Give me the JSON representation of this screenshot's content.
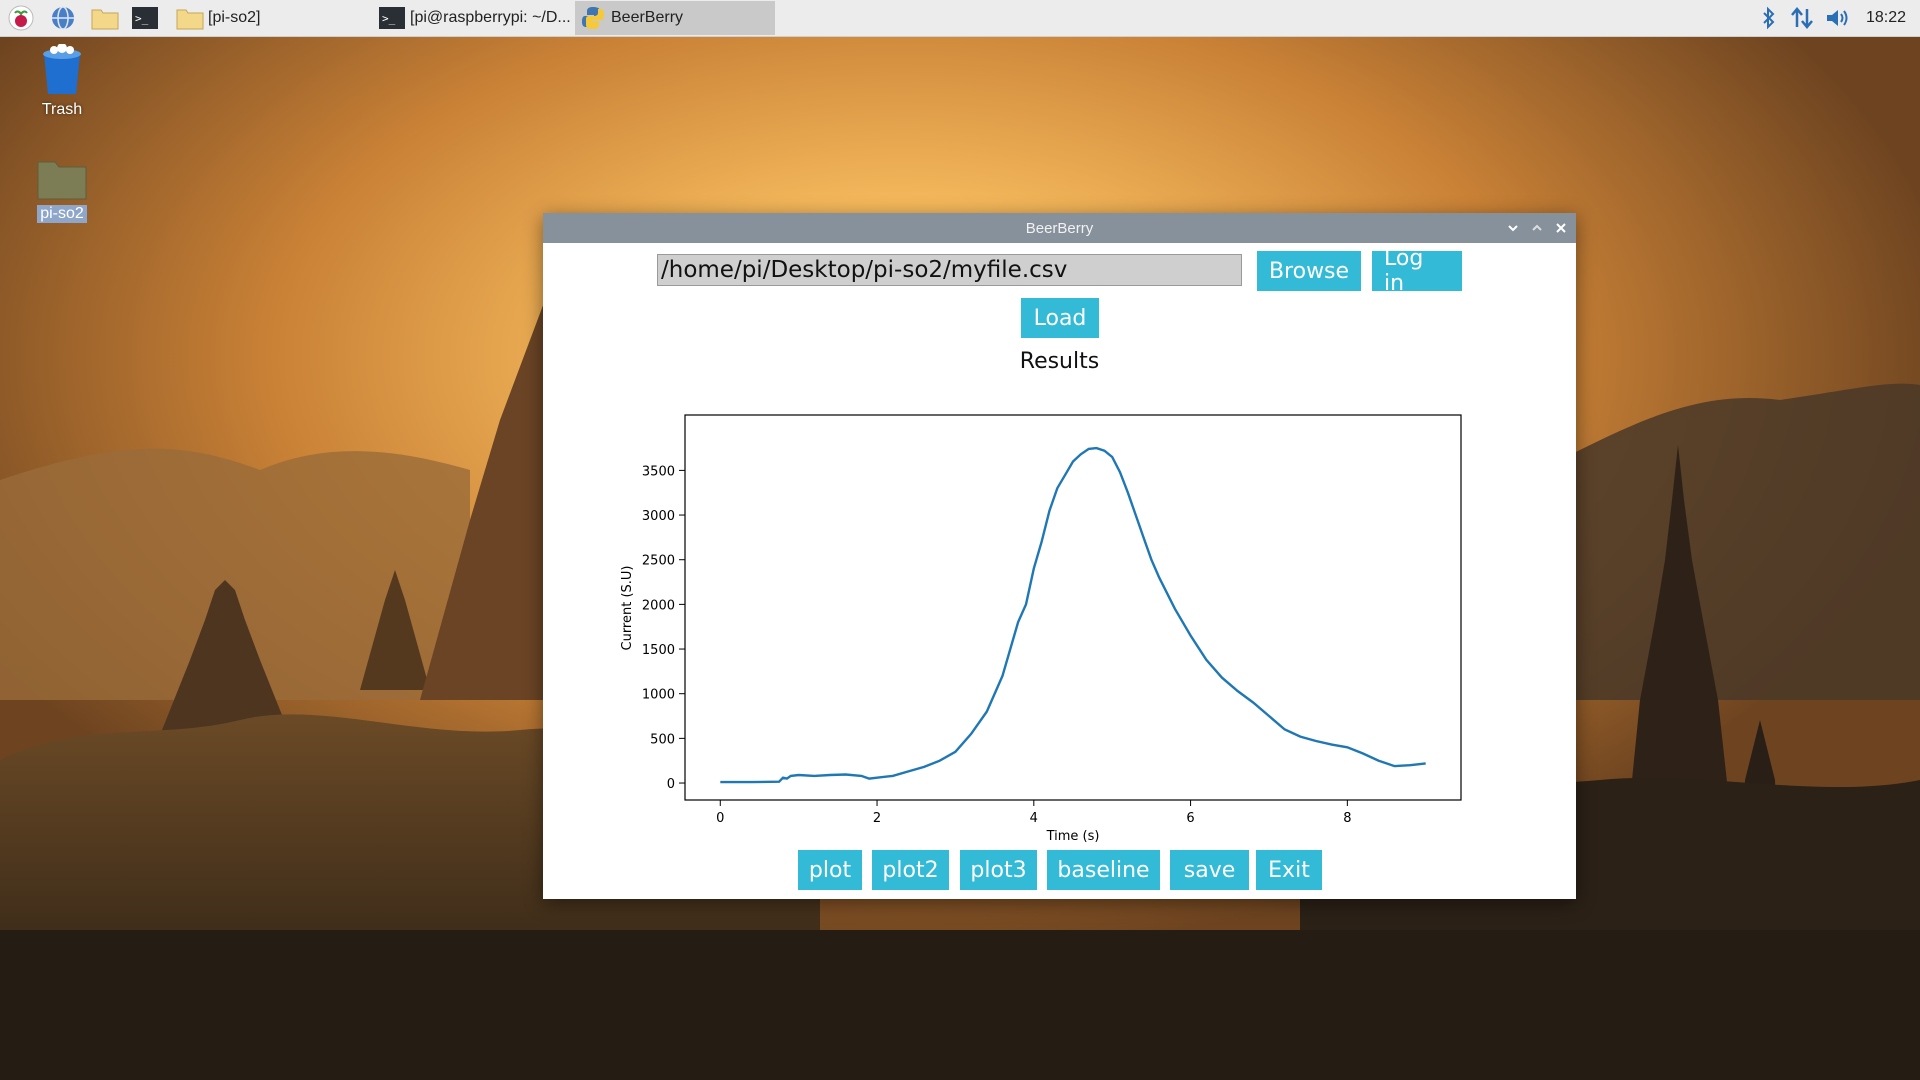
{
  "taskbar": {
    "tasks": [
      {
        "label": "[pi-so2]",
        "icon": "folder-icon"
      },
      {
        "label": "[pi@raspberrypi: ~/D...",
        "icon": "terminal-icon"
      },
      {
        "label": "BeerBerry",
        "icon": "python-icon"
      }
    ],
    "clock": "18:22"
  },
  "desktop": {
    "icons": [
      {
        "label": "Trash",
        "icon": "trash-icon"
      },
      {
        "label": "pi-so2",
        "icon": "folder-icon"
      }
    ]
  },
  "window": {
    "title": "BeerBerry",
    "file_path": "/home/pi/Desktop/pi-so2/myfile.csv",
    "buttons": {
      "browse": "Browse",
      "login": "Log in",
      "load": "Load",
      "plot": "plot",
      "plot2": "plot2",
      "plot3": "plot3",
      "baseline": "baseline",
      "save": "save",
      "exit": "Exit"
    },
    "results_label": "Results"
  },
  "colors": {
    "button": "#33bad6",
    "line": "#1f77b4",
    "titlebar": "#87919b"
  },
  "chart_data": {
    "type": "line",
    "title": "",
    "xlabel": "Time (s)",
    "ylabel": "Current (S.U)",
    "xlim": [
      -0.45,
      9.45
    ],
    "ylim": [
      -190,
      4120
    ],
    "xticks": [
      0,
      2,
      4,
      6,
      8
    ],
    "yticks": [
      0,
      500,
      1000,
      1500,
      2000,
      2500,
      3000,
      3500
    ],
    "series": [
      {
        "x": [
          0,
          0.4,
          0.75,
          0.8,
          0.85,
          0.9,
          1.0,
          1.2,
          1.4,
          1.6,
          1.8,
          1.9,
          2.0,
          2.2,
          2.4,
          2.6,
          2.8,
          3.0,
          3.2,
          3.4,
          3.6,
          3.8,
          3.9,
          4.0,
          4.1,
          4.2,
          4.3,
          4.4,
          4.5,
          4.6,
          4.7,
          4.8,
          4.9,
          5.0,
          5.1,
          5.2,
          5.3,
          5.4,
          5.5,
          5.6,
          5.8,
          6.0,
          6.2,
          6.4,
          6.6,
          6.8,
          7.0,
          7.2,
          7.4,
          7.6,
          7.8,
          8.0,
          8.2,
          8.4,
          8.6,
          8.8,
          9.0
        ],
        "y": [
          10,
          10,
          15,
          60,
          50,
          80,
          90,
          80,
          90,
          95,
          80,
          50,
          60,
          80,
          130,
          180,
          250,
          350,
          550,
          800,
          1200,
          1800,
          2000,
          2400,
          2700,
          3050,
          3300,
          3450,
          3600,
          3680,
          3740,
          3750,
          3720,
          3650,
          3480,
          3250,
          3000,
          2750,
          2500,
          2300,
          1950,
          1650,
          1380,
          1180,
          1030,
          900,
          750,
          600,
          520,
          470,
          430,
          400,
          330,
          250,
          190,
          200,
          220
        ]
      }
    ]
  }
}
